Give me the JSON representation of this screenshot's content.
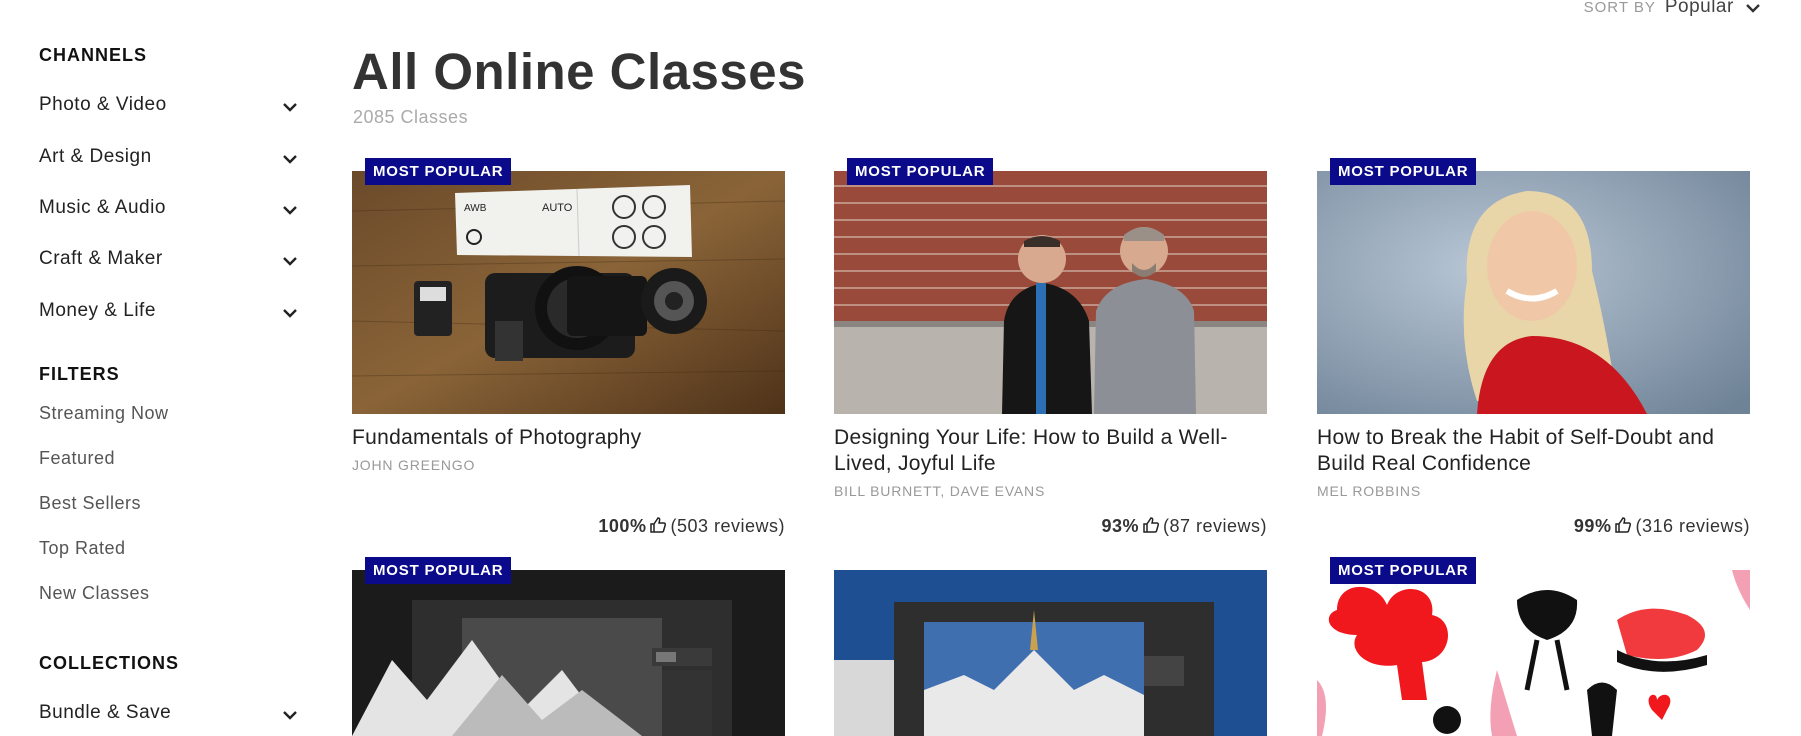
{
  "sidebar": {
    "channels_heading": "CHANNELS",
    "channels": [
      {
        "label": "Photo & Video"
      },
      {
        "label": "Art & Design"
      },
      {
        "label": "Music & Audio"
      },
      {
        "label": "Craft & Maker"
      },
      {
        "label": "Money & Life"
      }
    ],
    "filters_heading": "FILTERS",
    "filters": [
      {
        "label": "Streaming Now"
      },
      {
        "label": "Featured"
      },
      {
        "label": "Best Sellers"
      },
      {
        "label": "Top Rated"
      },
      {
        "label": "New Classes"
      }
    ],
    "collections_heading": "COLLECTIONS",
    "collections": [
      {
        "label": "Bundle & Save"
      }
    ]
  },
  "header": {
    "sort_label": "SORT BY",
    "sort_value": "Popular",
    "title": "All Online Classes",
    "count": "2085 Classes"
  },
  "cards": [
    {
      "badge": "MOST POPULAR",
      "title": "Fundamentals of Photography",
      "author": "JOHN GREENGO",
      "pct": "100%",
      "reviews": "(503 reviews)"
    },
    {
      "badge": "MOST POPULAR",
      "title": "Designing Your Life: How to Build a Well-Lived, Joyful Life",
      "author": "BILL BURNETT, DAVE EVANS",
      "pct": "93%",
      "reviews": "(87 reviews)"
    },
    {
      "badge": "MOST POPULAR",
      "title": "How to Break the Habit of Self-Doubt and Build Real Confidence",
      "author": "MEL ROBBINS",
      "pct": "99%",
      "reviews": "(316 reviews)"
    },
    {
      "badge": "MOST POPULAR"
    },
    {},
    {
      "badge": "MOST POPULAR"
    }
  ],
  "thumb_icons": {
    "card0": [
      "AWB",
      "AUTO"
    ]
  },
  "colors": {
    "badge_bg": "#0a0a8a",
    "title": "#333333",
    "muted": "#aaaaaa"
  }
}
